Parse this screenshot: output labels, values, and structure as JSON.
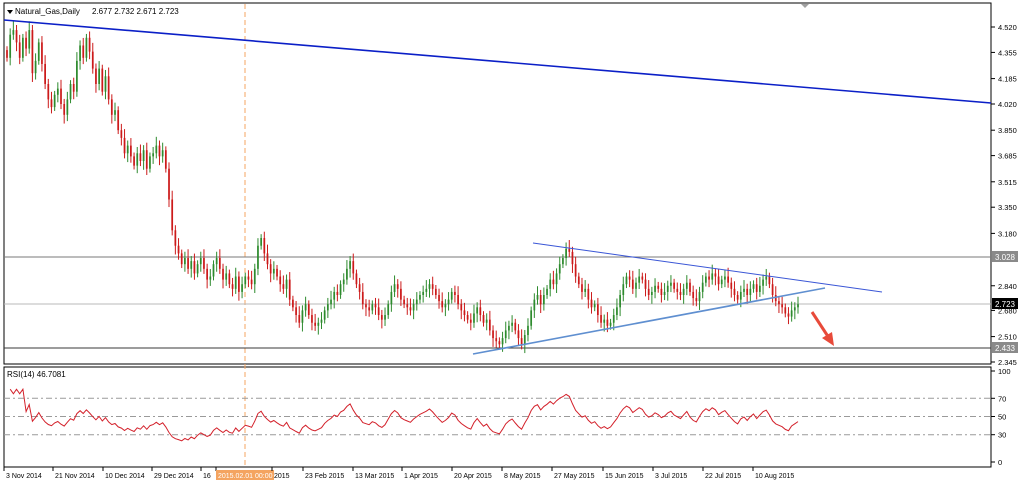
{
  "chart_data": [
    {
      "type": "candlestick",
      "header": {
        "symbol": "Natural_Gas,Daily",
        "ohlc": "2.677 2.732 2.671 2.723"
      },
      "y_ticks": [
        "4.520",
        "4.355",
        "4.185",
        "4.020",
        "3.850",
        "3.685",
        "3.515",
        "3.350",
        "3.180",
        "2.840",
        "2.680",
        "2.510",
        "2.345"
      ],
      "y_range": [
        2.27,
        4.62
      ],
      "price_labels": [
        {
          "name": "resistance",
          "value": "3.028",
          "color": "#8a8a8a"
        },
        {
          "name": "current",
          "value": "2.723",
          "color": "#000000"
        },
        {
          "name": "support",
          "value": "2.433",
          "color": "#8a8a8a"
        }
      ],
      "x_ticks": [
        "3 Nov 2014",
        "21 Nov 2014",
        "10 Dec 2014",
        "29 Dec 2014",
        "16",
        "2015.02.01 00:00",
        "2015",
        "23 Feb 2015",
        "13 Mar 2015",
        "1 Apr 2015",
        "20 Apr 2015",
        "8 May 2015",
        "27 May 2015",
        "15 Jun 2015",
        "3 Jul 2015",
        "22 Jul 2015",
        "10 Aug 2015"
      ],
      "colors": {
        "bull": "#2e8b2e",
        "bear": "#cc1a1a",
        "trendline": "#0b1fc7",
        "channel_line": "#3a56d6",
        "support_line": "#5f8fd0",
        "arrow": "#e84a3a",
        "marker": "#f4a460"
      },
      "closes": [
        4.32,
        4.47,
        4.5,
        4.42,
        4.32,
        4.45,
        4.38,
        4.5,
        4.22,
        4.3,
        4.42,
        4.28,
        4.15,
        4.05,
        4.0,
        4.08,
        4.12,
        4.02,
        3.95,
        4.05,
        4.15,
        4.1,
        4.3,
        4.4,
        4.32,
        4.45,
        4.36,
        4.25,
        4.15,
        4.25,
        4.1,
        4.2,
        4.05,
        3.95,
        3.98,
        3.85,
        3.8,
        3.7,
        3.75,
        3.68,
        3.62,
        3.7,
        3.65,
        3.72,
        3.6,
        3.68,
        3.7,
        3.75,
        3.68,
        3.72,
        3.6,
        3.4,
        3.2,
        3.1,
        3.05,
        2.98,
        3.02,
        2.95,
        3.0,
        2.92,
        2.98,
        3.02,
        2.95,
        2.88,
        2.9,
        2.98,
        3.02,
        2.95,
        2.88,
        2.92,
        2.85,
        2.82,
        2.9,
        2.8,
        2.85,
        2.9,
        2.88,
        2.85,
        2.95,
        3.1,
        3.15,
        3.05,
        2.98,
        2.92,
        2.95,
        2.9,
        2.85,
        2.82,
        2.88,
        2.75,
        2.7,
        2.65,
        2.6,
        2.68,
        2.72,
        2.65,
        2.6,
        2.58,
        2.6,
        2.62,
        2.68,
        2.72,
        2.75,
        2.8,
        2.78,
        2.85,
        2.88,
        2.95,
        3.0,
        2.92,
        2.85,
        2.8,
        2.72,
        2.7,
        2.68,
        2.72,
        2.7,
        2.65,
        2.62,
        2.65,
        2.72,
        2.8,
        2.85,
        2.82,
        2.75,
        2.72,
        2.7,
        2.68,
        2.72,
        2.75,
        2.78,
        2.8,
        2.82,
        2.85,
        2.82,
        2.78,
        2.74,
        2.7,
        2.72,
        2.75,
        2.8,
        2.78,
        2.72,
        2.68,
        2.65,
        2.62,
        2.6,
        2.66,
        2.7,
        2.65,
        2.6,
        2.62,
        2.55,
        2.5,
        2.48,
        2.46,
        2.5,
        2.55,
        2.58,
        2.6,
        2.55,
        2.5,
        2.46,
        2.52,
        2.58,
        2.68,
        2.75,
        2.78,
        2.72,
        2.78,
        2.82,
        2.88,
        2.85,
        2.92,
        2.98,
        3.02,
        3.08,
        3.06,
        2.98,
        2.9,
        2.85,
        2.8,
        2.82,
        2.75,
        2.7,
        2.72,
        2.65,
        2.6,
        2.62,
        2.58,
        2.6,
        2.65,
        2.7,
        2.78,
        2.85,
        2.9,
        2.88,
        2.82,
        2.86,
        2.9,
        2.88,
        2.82,
        2.78,
        2.8,
        2.84,
        2.82,
        2.78,
        2.8,
        2.84,
        2.86,
        2.82,
        2.8,
        2.78,
        2.82,
        2.86,
        2.8,
        2.76,
        2.74,
        2.8,
        2.86,
        2.9,
        2.88,
        2.92,
        2.9,
        2.85,
        2.88,
        2.9,
        2.86,
        2.82,
        2.78,
        2.75,
        2.8,
        2.82,
        2.78,
        2.82,
        2.85,
        2.8,
        2.84,
        2.88,
        2.9,
        2.85,
        2.78,
        2.74,
        2.72,
        2.7,
        2.66,
        2.64,
        2.68,
        2.7,
        2.72
      ],
      "rsi": {
        "label": "RSI(14) 46.7081",
        "ticks": [
          "100",
          "70",
          "50",
          "30",
          "0"
        ],
        "levels": [
          70,
          50,
          30
        ],
        "range": [
          0,
          100
        ],
        "color": "#d3202a"
      }
    }
  ]
}
